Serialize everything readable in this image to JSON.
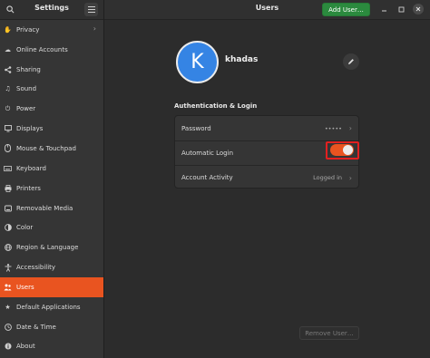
{
  "sidebar": {
    "title": "Settings",
    "items": [
      {
        "label": "Privacy",
        "icon": "hand-icon",
        "has_chevron": true
      },
      {
        "label": "Online Accounts",
        "icon": "cloud-icon"
      },
      {
        "label": "Sharing",
        "icon": "share-icon"
      },
      {
        "label": "Sound",
        "icon": "music-note-icon"
      },
      {
        "label": "Power",
        "icon": "power-icon"
      },
      {
        "label": "Displays",
        "icon": "monitor-icon"
      },
      {
        "label": "Mouse & Touchpad",
        "icon": "mouse-icon"
      },
      {
        "label": "Keyboard",
        "icon": "keyboard-icon"
      },
      {
        "label": "Printers",
        "icon": "printer-icon"
      },
      {
        "label": "Removable Media",
        "icon": "media-icon"
      },
      {
        "label": "Color",
        "icon": "color-icon"
      },
      {
        "label": "Region & Language",
        "icon": "globe-icon"
      },
      {
        "label": "Accessibility",
        "icon": "accessibility-icon"
      },
      {
        "label": "Users",
        "icon": "users-icon",
        "active": true
      },
      {
        "label": "Default Applications",
        "icon": "star-icon"
      },
      {
        "label": "Date & Time",
        "icon": "clock-icon"
      },
      {
        "label": "About",
        "icon": "info-icon"
      }
    ]
  },
  "header": {
    "title": "Users",
    "add_user_label": "Add User…"
  },
  "user": {
    "initial": "K",
    "name": "khadas"
  },
  "auth": {
    "section_title": "Authentication & Login",
    "password_label": "Password",
    "password_value": "•••••",
    "auto_login_label": "Automatic Login",
    "auto_login_enabled": true,
    "activity_label": "Account Activity",
    "activity_value": "Logged in"
  },
  "actions": {
    "remove_user_label": "Remove User…"
  },
  "colors": {
    "accent": "#e95420",
    "add_button": "#2b8a3e",
    "avatar": "#3584e4",
    "highlight_outline": "#e32020"
  }
}
